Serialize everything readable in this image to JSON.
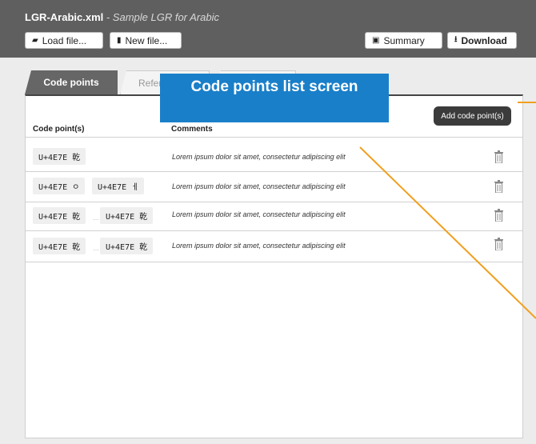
{
  "app": {
    "filename": "LGR-Arabic.xml",
    "subtitle": " - Sample LGR for Arabic"
  },
  "toolbar": {
    "load_label": "Load file...",
    "new_label": "New file...",
    "summary_label": "Summary",
    "download_label": "Download"
  },
  "tabs": [
    {
      "label": "Code points"
    },
    {
      "label": "Refer"
    },
    {
      "label": ""
    }
  ],
  "callout": {
    "text": "Code points list screen"
  },
  "add_button_label": "Add code point(s)",
  "table": {
    "headers": [
      "Code point(s)",
      "Comments"
    ],
    "rows": [
      {
        "cps": [
          "U+4E7E 乾"
        ],
        "comment": "Lorem ipsum dolor sit amet, consectetur adipiscing elit"
      },
      {
        "cps": [
          "U+4E7E ㅇ",
          "U+4E7E ㅔ"
        ],
        "comment": "Lorem ipsum dolor sit amet, consectetur adipiscing elit"
      },
      {
        "cps": [
          "U+4E7E 乾",
          "U+4E7E 乾"
        ],
        "comment": "Lorem ipsum dolor sit amet, consectetur adipiscing elit"
      },
      {
        "cps": [
          "U+4E7E 乾",
          "U+4E7E 乾"
        ],
        "comment": "Lorem ipsum dolor sit amet, consectetur adipiscing elit"
      }
    ],
    "range_separator": "…"
  },
  "colors": {
    "header_bg": "#5f5f5f",
    "callout_bg": "#1a7fc9",
    "annotation_line": "#f0a020"
  },
  "icons": [
    "folder-icon",
    "new-file-icon",
    "clipboard-icon",
    "download-icon",
    "trash-icon"
  ]
}
